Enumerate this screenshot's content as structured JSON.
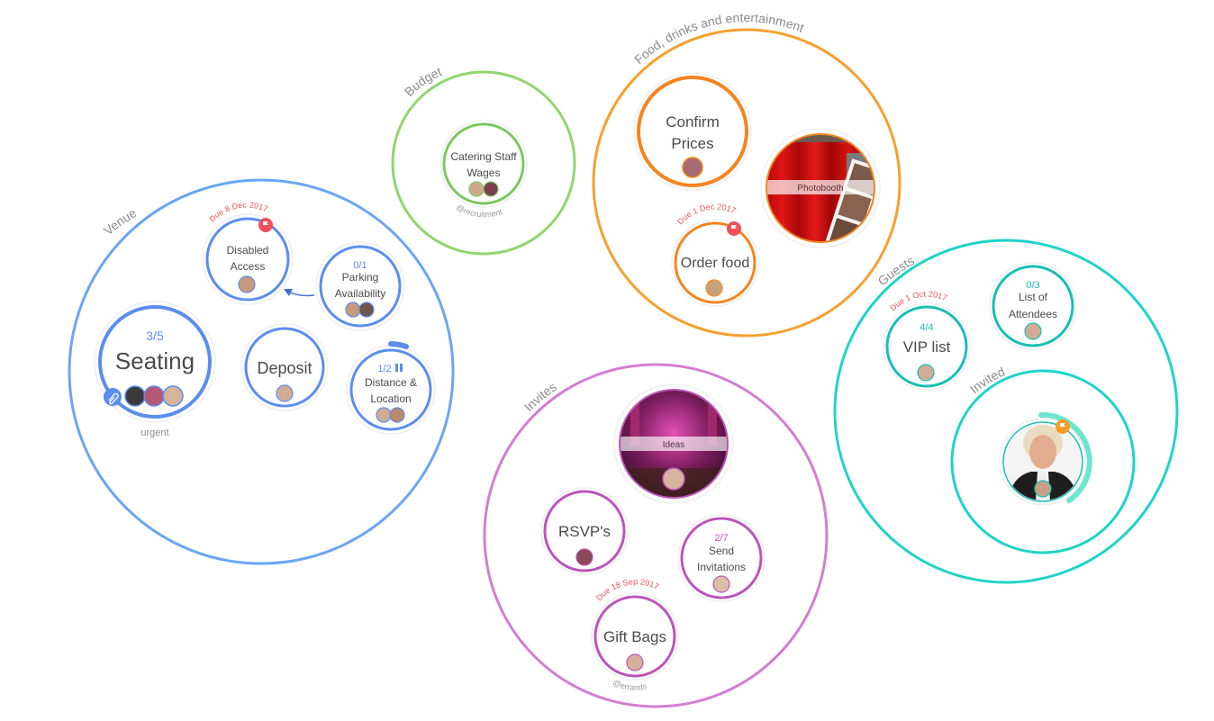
{
  "colors": {
    "venue": "#6aa5f5",
    "venue_task": "#5b8def",
    "budget": "#8fd66f",
    "budget_task": "#7cc862",
    "food": "#f6a02d",
    "food_task": "#f5841f",
    "invites": "#d37dd3",
    "invites_task": "#bb55bb",
    "guests": "#1fd3c9",
    "guests_task": "#18bfb6",
    "due": "#f0505a",
    "flag": "#f0505a",
    "flag_orange": "#f59b25"
  },
  "groups": [
    {
      "id": "venue",
      "label": "Venue"
    },
    {
      "id": "budget",
      "label": "Budget"
    },
    {
      "id": "food",
      "label": "Food, drinks and entertainment"
    },
    {
      "id": "invites",
      "label": "Invites"
    },
    {
      "id": "guests",
      "label": "Guests"
    },
    {
      "id": "invited",
      "label": "Invited"
    }
  ],
  "tasks": {
    "seating": {
      "title": "Seating",
      "progress": "3/5",
      "tag": "urgent",
      "attachment": true,
      "avatars": 3
    },
    "disabled_access": {
      "title_lines": [
        "Disabled",
        "Access"
      ],
      "due": "Due 8 Dec 2017",
      "flag": true,
      "avatars": 1
    },
    "parking": {
      "title_lines": [
        "Parking",
        "Availability"
      ],
      "progress": "0/1",
      "avatars": 2
    },
    "deposit": {
      "title": "Deposit",
      "avatars": 1
    },
    "distance": {
      "title_lines": [
        "Distance &",
        "Location"
      ],
      "progress": "1/2",
      "paused": true,
      "avatars": 2
    },
    "catering": {
      "title_lines": [
        "Catering Staff",
        "Wages"
      ],
      "tag": "@recruitment",
      "avatars": 2
    },
    "confirm_prices": {
      "title_lines": [
        "Confirm",
        "Prices"
      ],
      "avatars": 1
    },
    "photobooth": {
      "title": "Photobooth",
      "image": "photobooth"
    },
    "order_food": {
      "title": "Order food",
      "due": "Due 1 Dec 2017",
      "flag": true,
      "avatars": 1
    },
    "ideas": {
      "title": "Ideas",
      "image": "party-venue",
      "avatars": 1
    },
    "rsvps": {
      "title": "RSVP's",
      "avatars": 1
    },
    "send_invitations": {
      "title_lines": [
        "Send",
        "Invitations"
      ],
      "progress": "2/7",
      "avatars": 1
    },
    "gift_bags": {
      "title": "Gift Bags",
      "due": "Due 18 Sep 2017",
      "tag": "@errands",
      "avatars": 1
    },
    "vip_list": {
      "title": "VIP list",
      "progress": "4/4",
      "due": "Due 1 Oct 2017",
      "avatars": 1
    },
    "attendees": {
      "title_lines": [
        "List of",
        "Attendees"
      ],
      "progress": "0/3",
      "avatars": 1
    },
    "invited_person": {
      "image": "person-photo",
      "flag": true,
      "progress_ring": 0.3,
      "avatars": 1
    }
  }
}
